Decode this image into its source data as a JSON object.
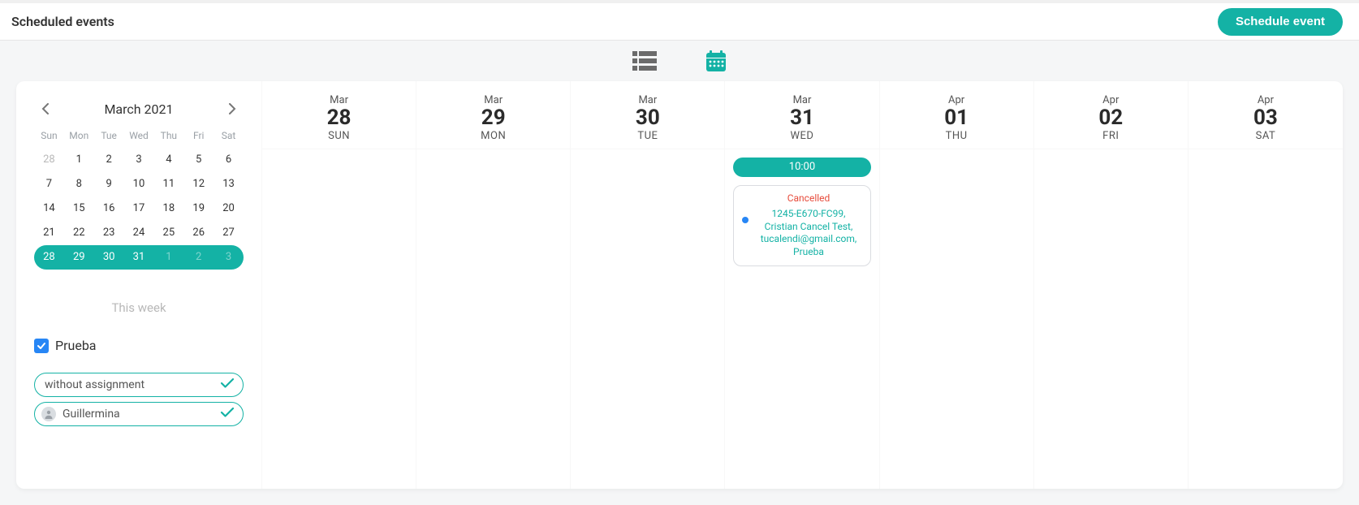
{
  "header": {
    "title": "Scheduled events",
    "schedule_button": "Schedule event"
  },
  "view_switch": {
    "list_icon": "list-icon",
    "calendar_icon": "calendar-icon"
  },
  "mini_calendar": {
    "title": "March 2021",
    "dow": [
      "Sun",
      "Mon",
      "Tue",
      "Wed",
      "Thu",
      "Fri",
      "Sat"
    ],
    "rows": [
      [
        {
          "d": "28",
          "muted": true
        },
        {
          "d": "1"
        },
        {
          "d": "2"
        },
        {
          "d": "3"
        },
        {
          "d": "4"
        },
        {
          "d": "5"
        },
        {
          "d": "6"
        }
      ],
      [
        {
          "d": "7"
        },
        {
          "d": "8"
        },
        {
          "d": "9"
        },
        {
          "d": "10"
        },
        {
          "d": "11"
        },
        {
          "d": "12"
        },
        {
          "d": "13"
        }
      ],
      [
        {
          "d": "14"
        },
        {
          "d": "15"
        },
        {
          "d": "16"
        },
        {
          "d": "17"
        },
        {
          "d": "18"
        },
        {
          "d": "19"
        },
        {
          "d": "20"
        }
      ],
      [
        {
          "d": "21"
        },
        {
          "d": "22"
        },
        {
          "d": "23"
        },
        {
          "d": "24"
        },
        {
          "d": "25"
        },
        {
          "d": "26"
        },
        {
          "d": "27"
        }
      ]
    ],
    "selected_row": [
      {
        "d": "28"
      },
      {
        "d": "29"
      },
      {
        "d": "30"
      },
      {
        "d": "31"
      },
      {
        "d": "1",
        "off": true
      },
      {
        "d": "2",
        "off": true
      },
      {
        "d": "3",
        "off": true
      }
    ],
    "this_week": "This week"
  },
  "filters": {
    "event_type": {
      "label": "Prueba",
      "checked": true
    },
    "people": [
      {
        "label": "without assignment",
        "avatar": false
      },
      {
        "label": "Guillermina",
        "avatar": true
      }
    ]
  },
  "week": {
    "days": [
      {
        "month": "Mar",
        "num": "28",
        "dow": "SUN"
      },
      {
        "month": "Mar",
        "num": "29",
        "dow": "MON"
      },
      {
        "month": "Mar",
        "num": "30",
        "dow": "TUE"
      },
      {
        "month": "Mar",
        "num": "31",
        "dow": "WED"
      },
      {
        "month": "Apr",
        "num": "01",
        "dow": "THU"
      },
      {
        "month": "Apr",
        "num": "02",
        "dow": "FRI"
      },
      {
        "month": "Apr",
        "num": "03",
        "dow": "SAT"
      }
    ],
    "event": {
      "day_index": 3,
      "time": "10:00",
      "status": "Cancelled",
      "desc": "1245-E670-FC99, Cristian Cancel Test, tucalendi@gmail.com, Prueba"
    }
  },
  "colors": {
    "teal": "#14b2a5",
    "blue": "#2786f5",
    "red": "#e74c3c"
  }
}
